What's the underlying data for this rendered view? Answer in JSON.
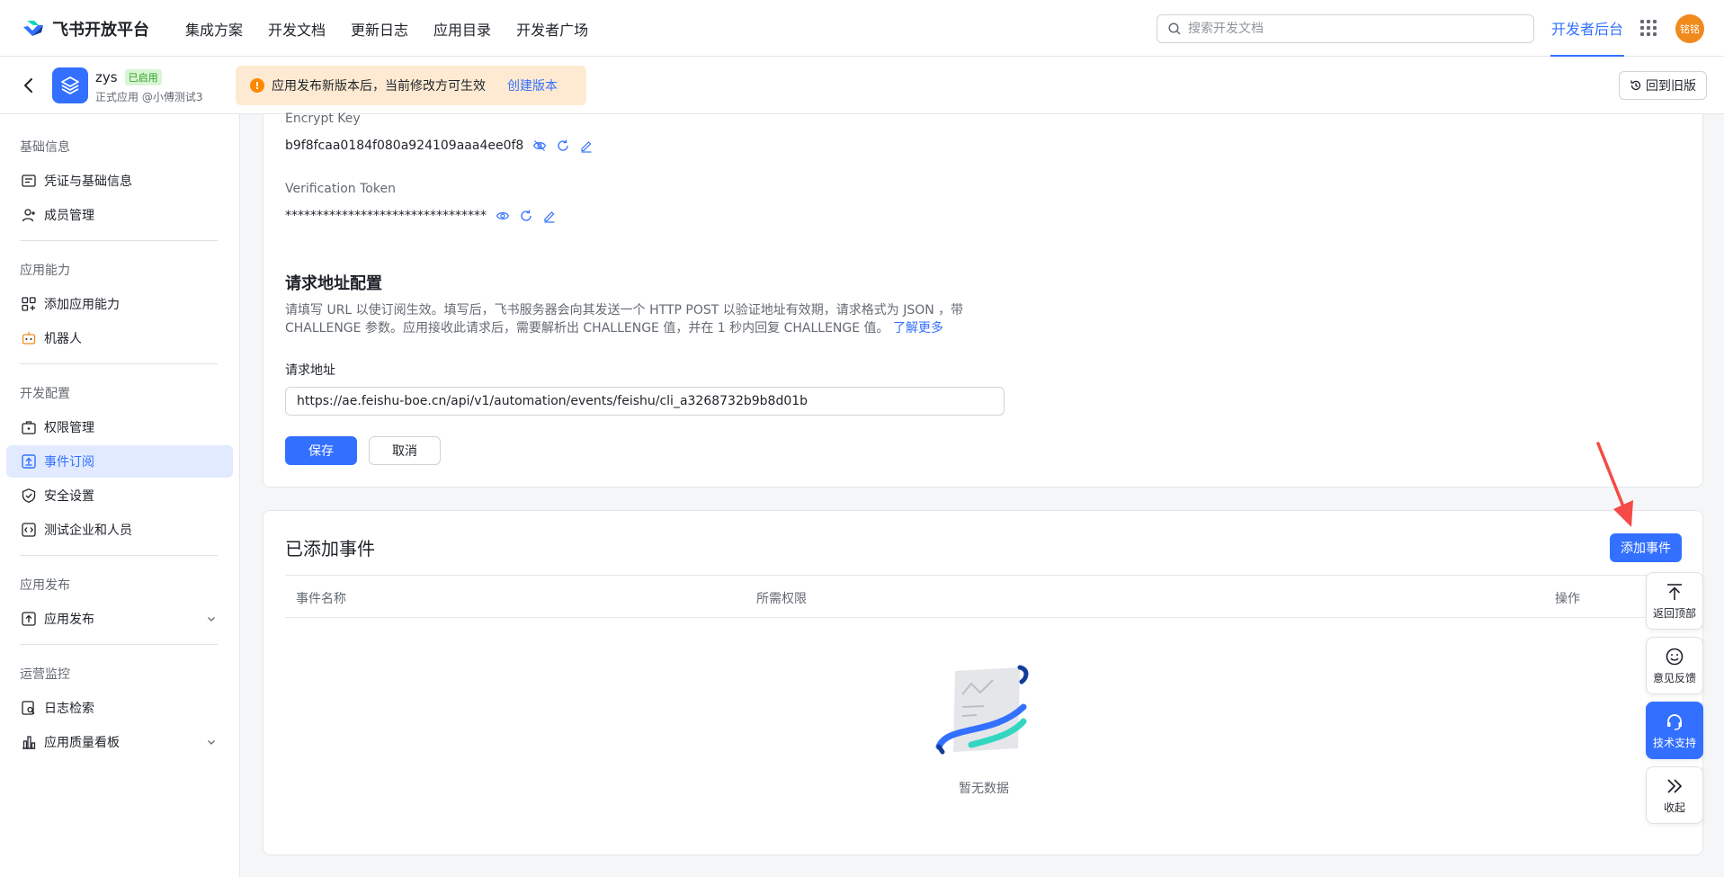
{
  "topnav": {
    "brand": "飞书开放平台",
    "items": [
      "集成方案",
      "开发文档",
      "更新日志",
      "应用目录",
      "开发者广场"
    ],
    "search_placeholder": "搜索开发文档",
    "dev_console": "开发者后台",
    "avatar_text": "铭铭"
  },
  "app": {
    "name": "zys",
    "status": "已启用",
    "subtitle": "正式应用 @小傅测试3"
  },
  "notice": {
    "text": "应用发布新版本后，当前修改方可生效",
    "link": "创建版本"
  },
  "old_version": "回到旧版",
  "sidebar": {
    "groups": [
      {
        "title": "基础信息",
        "items": [
          "凭证与基础信息",
          "成员管理"
        ]
      },
      {
        "title": "应用能力",
        "items": [
          "添加应用能力",
          "机器人"
        ]
      },
      {
        "title": "开发配置",
        "items": [
          "权限管理",
          "事件订阅",
          "安全设置",
          "测试企业和人员"
        ]
      },
      {
        "title": "应用发布",
        "items": [
          "应用发布"
        ]
      },
      {
        "title": "运营监控",
        "items": [
          "日志检索",
          "应用质量看板"
        ]
      }
    ]
  },
  "encrypt": {
    "label": "Encrypt Key",
    "value": "b9f8fcaa0184f080a924109aaa4ee0f8"
  },
  "token": {
    "label": "Verification Token",
    "value": "********************************"
  },
  "request": {
    "title": "请求地址配置",
    "desc": "请填写 URL 以使订阅生效。填写后，飞书服务器会向其发送一个 HTTP POST 以验证地址有效期，请求格式为 JSON ，带 CHALLENGE 参数。应用接收此请求后，需要解析出 CHALLENGE 值，并在 1 秒内回复 CHALLENGE 值。",
    "learn_more": "了解更多",
    "url_label": "请求地址",
    "url_value": "https://ae.feishu-boe.cn/api/v1/automation/events/feishu/cli_a3268732b9b8d01b",
    "save": "保存",
    "cancel": "取消"
  },
  "events": {
    "title": "已添加事件",
    "add_button": "添加事件",
    "columns": [
      "事件名称",
      "所需权限",
      "操作"
    ],
    "empty": "暂无数据"
  },
  "float_tools": [
    "返回顶部",
    "意见反馈",
    "技术支持",
    "收起"
  ],
  "colors": {
    "primary": "#3370ff",
    "notice_bg": "#feead2",
    "warning": "#ff8800",
    "success": "#2ea121",
    "arrow": "#f54a45"
  }
}
